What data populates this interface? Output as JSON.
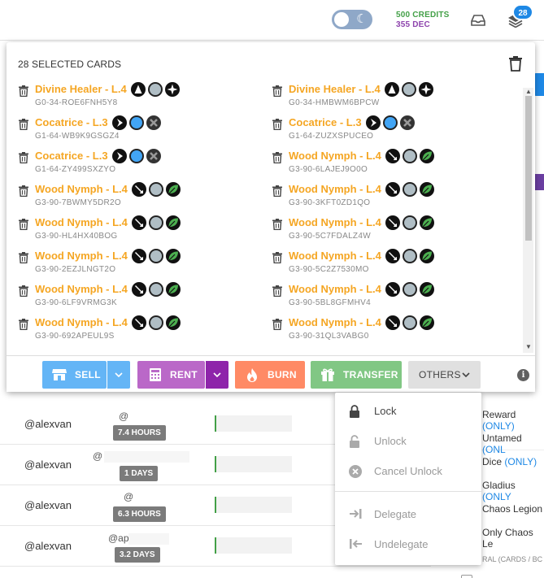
{
  "header": {
    "credits": "500 CREDITS",
    "dec": "355 DEC",
    "notification_count": "28"
  },
  "modal": {
    "title": "28 SELECTED CARDS",
    "cards": [
      {
        "name": "Divine Healer - L.4",
        "uid": "G0-34-ROE6FNH5Y8",
        "icons": [
          "life",
          "neutral",
          "compass"
        ]
      },
      {
        "name": "Divine Healer - L.4",
        "uid": "G0-34-HMBWM6BPCW",
        "icons": [
          "life",
          "neutral",
          "compass"
        ]
      },
      {
        "name": "Cocatrice - L.3",
        "uid": "G1-64-WB9K9GSGZ4",
        "icons": [
          "arrow",
          "water",
          "cross"
        ]
      },
      {
        "name": "Cocatrice - L.3",
        "uid": "G1-64-ZUZXSPUCEO",
        "icons": [
          "arrow",
          "water",
          "cross"
        ]
      },
      {
        "name": "Cocatrice - L.3",
        "uid": "G1-64-ZY499SXZYO",
        "icons": [
          "arrow",
          "water",
          "cross"
        ]
      },
      {
        "name": "Wood Nymph - L.4",
        "uid": "G3-90-6LAJEJ9O0O",
        "icons": [
          "melee",
          "neutral",
          "earth"
        ]
      },
      {
        "name": "Wood Nymph - L.4",
        "uid": "G3-90-7BWMY5DR2O",
        "icons": [
          "melee",
          "neutral",
          "earth"
        ]
      },
      {
        "name": "Wood Nymph - L.4",
        "uid": "G3-90-3KFT0ZD1QO",
        "icons": [
          "melee",
          "neutral",
          "earth"
        ]
      },
      {
        "name": "Wood Nymph - L.4",
        "uid": "G3-90-HL4HX40BOG",
        "icons": [
          "melee",
          "neutral",
          "earth"
        ]
      },
      {
        "name": "Wood Nymph - L.4",
        "uid": "G3-90-5C7FDALZ4W",
        "icons": [
          "melee",
          "neutral",
          "earth"
        ]
      },
      {
        "name": "Wood Nymph - L.4",
        "uid": "G3-90-2EZJLNGT2O",
        "icons": [
          "melee",
          "neutral",
          "earth"
        ]
      },
      {
        "name": "Wood Nymph - L.4",
        "uid": "G3-90-5C2Z7530MO",
        "icons": [
          "melee",
          "neutral",
          "earth"
        ]
      },
      {
        "name": "Wood Nymph - L.4",
        "uid": "G3-90-6LF9VRMG3K",
        "icons": [
          "melee",
          "neutral",
          "earth"
        ]
      },
      {
        "name": "Wood Nymph - L.4",
        "uid": "G3-90-5BL8GFMHV4",
        "icons": [
          "melee",
          "neutral",
          "earth"
        ]
      },
      {
        "name": "Wood Nymph - L.4",
        "uid": "G3-90-692APEUL9S",
        "icons": [
          "melee",
          "neutral",
          "earth"
        ]
      },
      {
        "name": "Wood Nymph - L.4",
        "uid": "G3-90-31QL3VABG0",
        "icons": [
          "melee",
          "neutral",
          "earth"
        ]
      }
    ],
    "buttons": {
      "sell": "SELL",
      "rent": "RENT",
      "burn": "BURN",
      "transfer": "TRANSFER",
      "others": "OTHERS"
    },
    "info": "i"
  },
  "others_menu": {
    "items": [
      {
        "label": "Lock",
        "enabled": true
      },
      {
        "label": "Unlock",
        "enabled": false
      },
      {
        "label": "Cancel Unlock",
        "enabled": false
      },
      {
        "label": "Delegate",
        "enabled": false
      },
      {
        "label": "Undelegate",
        "enabled": false
      }
    ]
  },
  "background": {
    "rows": [
      {
        "player": "@alexvan",
        "hours": "7.4 HOURS",
        "name": "@"
      },
      {
        "player": "@alexvan",
        "hours": "1 DAYS",
        "name": "@"
      },
      {
        "player": "@alexvan",
        "hours": "6.3 HOURS",
        "name": "@"
      },
      {
        "player": "@alexvan",
        "hours": "3.2 DAYS",
        "name": "@ap"
      }
    ],
    "right_items": [
      {
        "text": "Reward",
        "paren": "(ONLY)"
      },
      {
        "text": "Untamed",
        "paren": "(ONL"
      },
      {
        "text": "Dice",
        "paren": "(ONLY)"
      },
      {
        "text": "Gladius",
        "paren": "(ONLY"
      },
      {
        "text": "Chaos Legion",
        "paren": ""
      },
      {
        "text": "Only Chaos Le",
        "paren": ""
      }
    ],
    "right_footer": "RAL (CARDS / BC"
  },
  "colors": {
    "sell": "#64b5f6",
    "sell_split": "#64b5f6",
    "rent": "#ba68c8",
    "rent_split": "#8e24aa",
    "burn": "#ff8a65",
    "transfer": "#81c784",
    "others": "#e0e0e0",
    "card_name": "#f5a623"
  }
}
